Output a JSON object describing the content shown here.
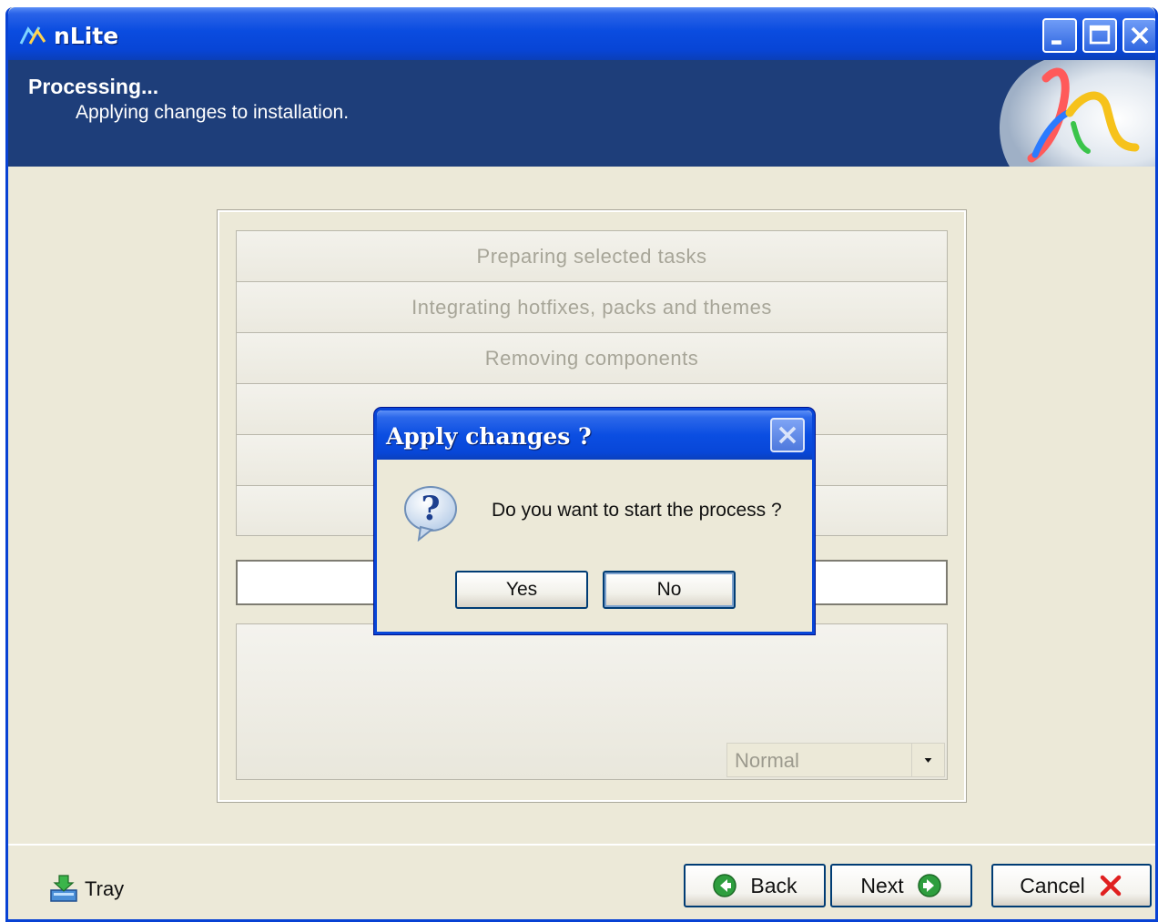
{
  "window": {
    "title": "nLite",
    "controls": [
      "minimize-icon",
      "maximize-icon",
      "close-icon"
    ]
  },
  "header": {
    "title": "Processing...",
    "subtitle": "Applying changes to installation."
  },
  "tasks": [
    "Preparing selected tasks",
    "Integrating hotfixes, packs and themes",
    "Removing components",
    "",
    "",
    ""
  ],
  "priority": {
    "selected": "Normal"
  },
  "footer": {
    "tray_label": "Tray",
    "back_label": "Back",
    "next_label": "Next",
    "cancel_label": "Cancel"
  },
  "dialog": {
    "title": "Apply changes ?",
    "message": "Do you want to start the process ?",
    "yes_label": "Yes",
    "no_label": "No",
    "icon": "question-icon"
  },
  "colors": {
    "header_band": "#1e3e7a",
    "titlebar_blue": "#0845d6",
    "window_face": "#ece9d8",
    "disabled_text": "#a7a598"
  }
}
